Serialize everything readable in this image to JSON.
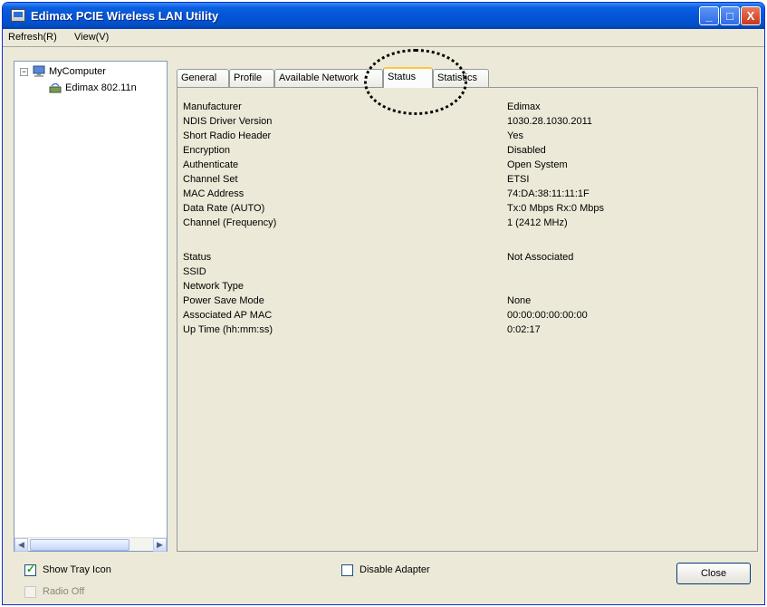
{
  "window": {
    "title": "Edimax PCIE Wireless LAN Utility",
    "buttons": {
      "minimize": "_",
      "maximize": "□",
      "close": "X"
    }
  },
  "menu": {
    "items": [
      "Refresh(R)",
      "View(V)"
    ]
  },
  "tree": {
    "root": "MyComputer",
    "child": "Edimax 802.11n"
  },
  "tabs": [
    {
      "label": "General",
      "active": false
    },
    {
      "label": "Profile",
      "active": false
    },
    {
      "label": "Available Network",
      "active": false
    },
    {
      "label": "Status",
      "active": true
    },
    {
      "label": "Statistics",
      "active": false
    }
  ],
  "status": {
    "group1": [
      {
        "label": "Manufacturer",
        "value": "Edimax"
      },
      {
        "label": "NDIS Driver Version",
        "value": "1030.28.1030.2011"
      },
      {
        "label": "Short Radio Header",
        "value": "Yes"
      },
      {
        "label": "Encryption",
        "value": "Disabled"
      },
      {
        "label": "Authenticate",
        "value": "Open System"
      },
      {
        "label": "Channel Set",
        "value": "ETSI"
      },
      {
        "label": "MAC Address",
        "value": "74:DA:38:11:11:1F"
      },
      {
        "label": "Data Rate (AUTO)",
        "value": "Tx:0 Mbps Rx:0 Mbps"
      },
      {
        "label": "Channel (Frequency)",
        "value": "1 (2412 MHz)"
      }
    ],
    "group2": [
      {
        "label": "Status",
        "value": "Not Associated"
      },
      {
        "label": "SSID",
        "value": ""
      },
      {
        "label": "Network Type",
        "value": ""
      },
      {
        "label": "Power Save Mode",
        "value": "None"
      },
      {
        "label": "Associated AP MAC",
        "value": "00:00:00:00:00:00"
      },
      {
        "label": "Up Time (hh:mm:ss)",
        "value": "0:02:17"
      }
    ]
  },
  "bottom": {
    "show_tray_icon": {
      "label": "Show Tray Icon",
      "checked": true
    },
    "radio_off": {
      "label": "Radio Off",
      "checked": false
    },
    "disable_adapter": {
      "label": "Disable Adapter",
      "checked": false
    },
    "close_button": "Close"
  },
  "colors": {
    "highlight_ring": "#000000",
    "titlebar": "#0454d8",
    "active_tab_accent": "#ffc83c"
  },
  "icons": {
    "app": "network-adapter-icon",
    "tree_root": "computer-icon",
    "tree_child": "wireless-adapter-icon"
  }
}
